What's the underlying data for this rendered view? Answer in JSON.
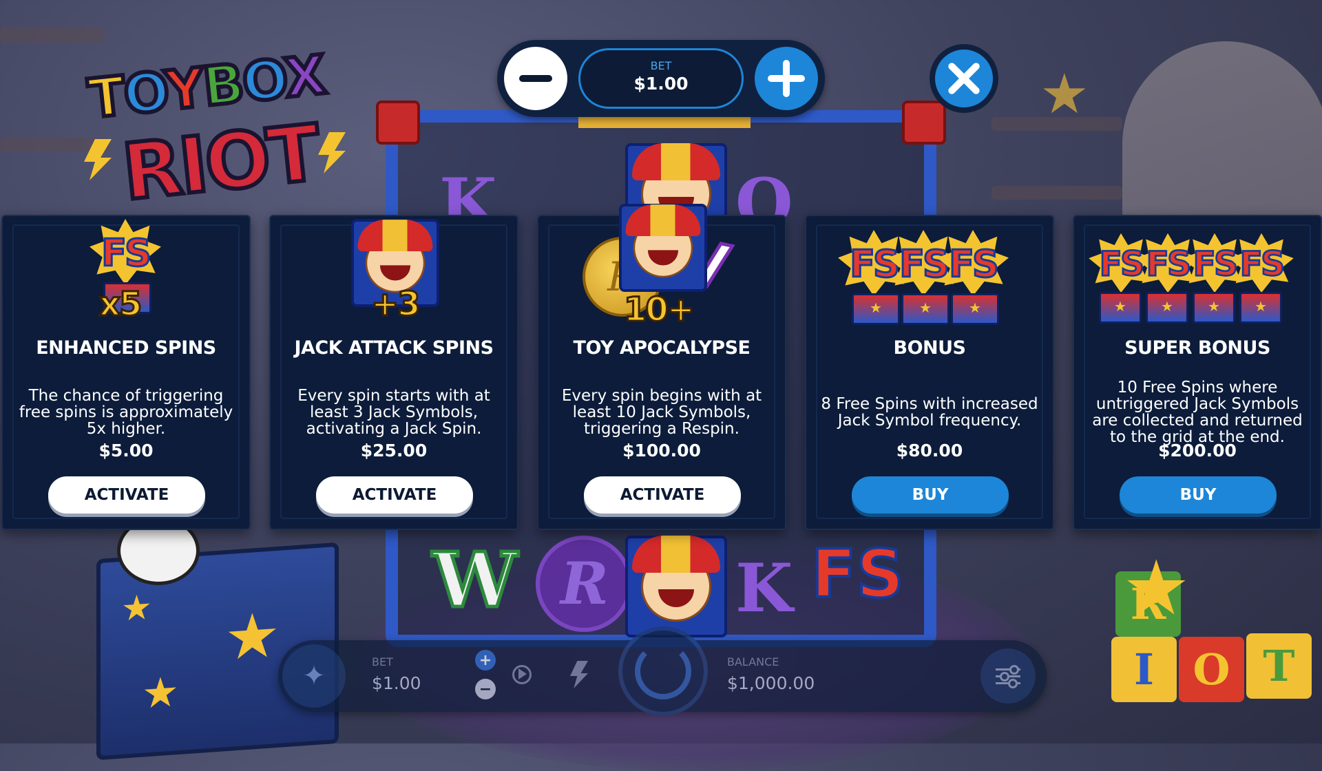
{
  "game": {
    "logo_line1": "TOYBOX",
    "logo_line2": "RIOT"
  },
  "bet_control": {
    "label": "BET",
    "value": "$1.00"
  },
  "cards": [
    {
      "art_label": "x5",
      "title": "ENHANCED SPINS",
      "description": "The chance of triggering free spins is approximately 5x higher.",
      "price": "$5.00",
      "action": "ACTIVATE"
    },
    {
      "art_label": "+3",
      "title": "JACK ATTACK SPINS",
      "description": "Every spin starts with at least 3 Jack Symbols, activating a Jack Spin.",
      "price": "$25.00",
      "action": "ACTIVATE"
    },
    {
      "art_label": "10+",
      "title": "TOY APOCALYPSE",
      "description": "Every spin begins with at least 10 Jack Symbols, triggering a Respin.",
      "price": "$100.00",
      "action": "ACTIVATE"
    },
    {
      "art_label": "",
      "title": "BONUS",
      "description": "8 Free Spins with increased Jack Symbol frequency.",
      "price": "$80.00",
      "action": "BUY"
    },
    {
      "art_label": "",
      "title": "SUPER BONUS",
      "description": "10 Free Spins where untriggered Jack Symbols are collected and returned to the grid at the end.",
      "price": "$200.00",
      "action": "BUY"
    }
  ],
  "reel_symbols": {
    "k": "K",
    "q": "Q",
    "w": "W",
    "r": "R",
    "fs": "FS"
  },
  "blocks": {
    "r": "R",
    "i": "I",
    "o": "O",
    "t": "T"
  },
  "bottom_bar": {
    "bet_label": "BET",
    "bet_value": "$1.00",
    "balance_label": "BALANCE",
    "balance_value": "$1,000.00",
    "plus": "+",
    "minus": "−"
  },
  "colors": {
    "panel": "#0c1c3a",
    "accent_blue": "#1d86d8",
    "gold": "#f4c430",
    "red": "#e53a2a"
  },
  "icons": [
    "minus-icon",
    "plus-icon",
    "close-icon",
    "wand-icon",
    "autoplay-icon",
    "lightning-icon",
    "spin-icon",
    "settings-sliders-icon"
  ]
}
